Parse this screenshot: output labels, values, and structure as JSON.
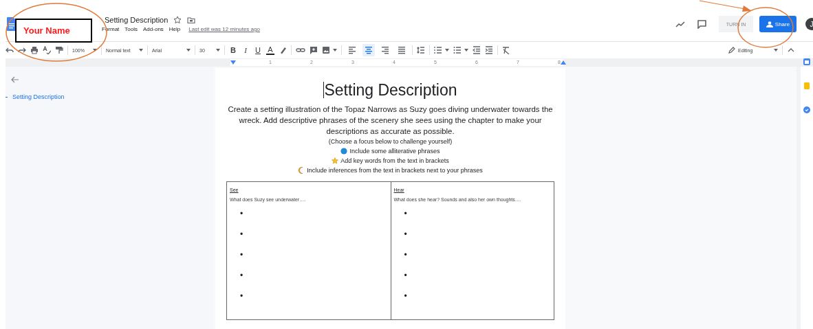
{
  "header": {
    "title": "Setting Description",
    "menu": [
      "Format",
      "Tools",
      "Add-ons",
      "Help"
    ],
    "last_edit": "Last edit was 12 minutes ago",
    "turn_in": "TURN IN",
    "share": "Share",
    "avatar": "J"
  },
  "toolbar": {
    "zoom": "100%",
    "style": "Normal text",
    "font": "Arial",
    "size": "30",
    "bold": "B",
    "italic": "I",
    "underline": "U",
    "text_color": "A",
    "align_buttons": [
      {
        "selected": false
      },
      {
        "selected": true
      },
      {
        "selected": false
      },
      {
        "selected": false
      }
    ],
    "mode": "Editing"
  },
  "ruler": [
    "1",
    "2",
    "3",
    "4",
    "5",
    "6",
    "7",
    "8"
  ],
  "outline": {
    "items": [
      {
        "text": "Setting Description"
      }
    ]
  },
  "document": {
    "title": "Setting Description",
    "intro": "Create a setting illustration of the Topaz Narrows as Suzy goes diving underwater towards the wreck. Add descriptive phrases of the scenery she sees using the chapter to make your descriptions as accurate as possible.",
    "focus_note": "(Choose a focus below to challenge yourself)",
    "challenges": [
      {
        "kind": "globe",
        "text": "Include some alliterative phrases"
      },
      {
        "kind": "star",
        "text": "Add key words from the text in brackets"
      },
      {
        "kind": "moon",
        "text": "Include inferences from the text in brackets next to your phrases"
      }
    ],
    "table": {
      "columns": [
        {
          "heading": "See",
          "prompt": "What does Suzy see underwater….",
          "bullets": [
            "•",
            "•",
            "•",
            "•",
            "•"
          ]
        },
        {
          "heading": "Hear",
          "prompt": "What does she hear? Sounds and also her own thoughts….",
          "bullets": [
            "•",
            "•",
            "•",
            "•",
            "•"
          ]
        }
      ]
    }
  },
  "annotation": {
    "label": "Your Name"
  }
}
